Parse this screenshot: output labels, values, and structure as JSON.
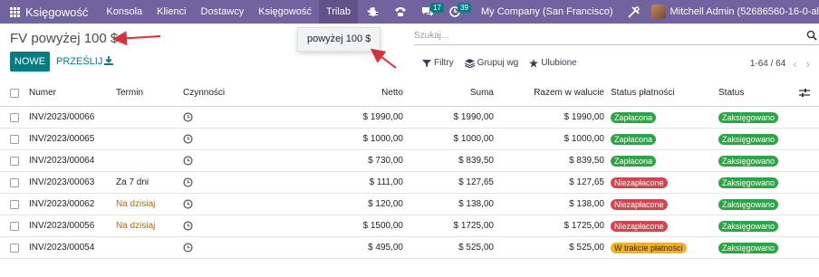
{
  "navbar": {
    "app_name": "Księgowość",
    "menu": [
      "Konsola",
      "Klienci",
      "Dostawcy",
      "Księgowość",
      "Trilab"
    ],
    "active_menu_index": 4,
    "plus_label": "+",
    "messages_count": "17",
    "activities_count": "39",
    "company": "My Company (San Francisco)",
    "user": "Mitchell Admin (52686560-16-0-al",
    "color": "#71639e"
  },
  "page": {
    "title": "FV powyżej 100 $",
    "new_label": "NOWE",
    "upload_label": "PRZEŚLIJ"
  },
  "dropdown": {
    "item_label": "powyżej 100 $"
  },
  "search": {
    "placeholder": "Szukaj..."
  },
  "filters": {
    "filter_label": "Filtry",
    "group_label": "Grupuj wg",
    "favorites_label": "Ulubione"
  },
  "pager": {
    "value": "1-64 / 64",
    "prev": "‹",
    "next": "›"
  },
  "table": {
    "headers": {
      "number": "Numer",
      "term": "Termin",
      "activities": "Czynności",
      "net": "Netto",
      "sum": "Suma",
      "currency_amount": "Razem w walucie",
      "payment_status": "Status płatności",
      "status": "Status"
    },
    "rows": [
      {
        "number": "INV/2023/00066",
        "term": "",
        "term_warn": false,
        "net": "$ 1990,00",
        "sum": "$ 1990,00",
        "currency_amount": "$ 1990,00",
        "payment_status": "Zapłacona",
        "payment_color": "green",
        "status": "Zaksięgowano"
      },
      {
        "number": "INV/2023/00065",
        "term": "",
        "term_warn": false,
        "net": "$ 1000,00",
        "sum": "$ 1000,00",
        "currency_amount": "$ 1000,00",
        "payment_status": "Zapłacona",
        "payment_color": "green",
        "status": "Zaksięgowano"
      },
      {
        "number": "INV/2023/00064",
        "term": "",
        "term_warn": false,
        "net": "$ 730,00",
        "sum": "$ 839,50",
        "currency_amount": "$ 839,50",
        "payment_status": "Zapłacona",
        "payment_color": "green",
        "status": "Zaksięgowano"
      },
      {
        "number": "INV/2023/00063",
        "term": "Za 7 dni",
        "term_warn": false,
        "net": "$ 111,00",
        "sum": "$ 127,65",
        "currency_amount": "$ 127,65",
        "payment_status": "Niezapłacone",
        "payment_color": "red",
        "status": "Zaksięgowano"
      },
      {
        "number": "INV/2023/00062",
        "term": "Na dzisiaj",
        "term_warn": true,
        "net": "$ 120,00",
        "sum": "$ 138,00",
        "currency_amount": "$ 138,00",
        "payment_status": "Niezapłacone",
        "payment_color": "red",
        "status": "Zaksięgowano"
      },
      {
        "number": "INV/2023/00056",
        "term": "Na dzisiaj",
        "term_warn": true,
        "net": "$ 1500,00",
        "sum": "$ 1725,00",
        "currency_amount": "$ 1725,00",
        "payment_status": "Niezapłacone",
        "payment_color": "red",
        "status": "Zaksięgowano"
      },
      {
        "number": "INV/2023/00054",
        "term": "",
        "term_warn": false,
        "net": "$ 495,00",
        "sum": "$ 525,00",
        "currency_amount": "$ 525,00",
        "payment_status": "W trakcie płatności",
        "payment_color": "orange",
        "status": "Zaksięgowano"
      }
    ]
  },
  "colors": {
    "primary": "#017e84",
    "navbar": "#71639e",
    "annotation_arrow": "#d9303e",
    "paid": "#28a745",
    "unpaid": "#d9434e",
    "in_payment": "#f3b11f"
  }
}
